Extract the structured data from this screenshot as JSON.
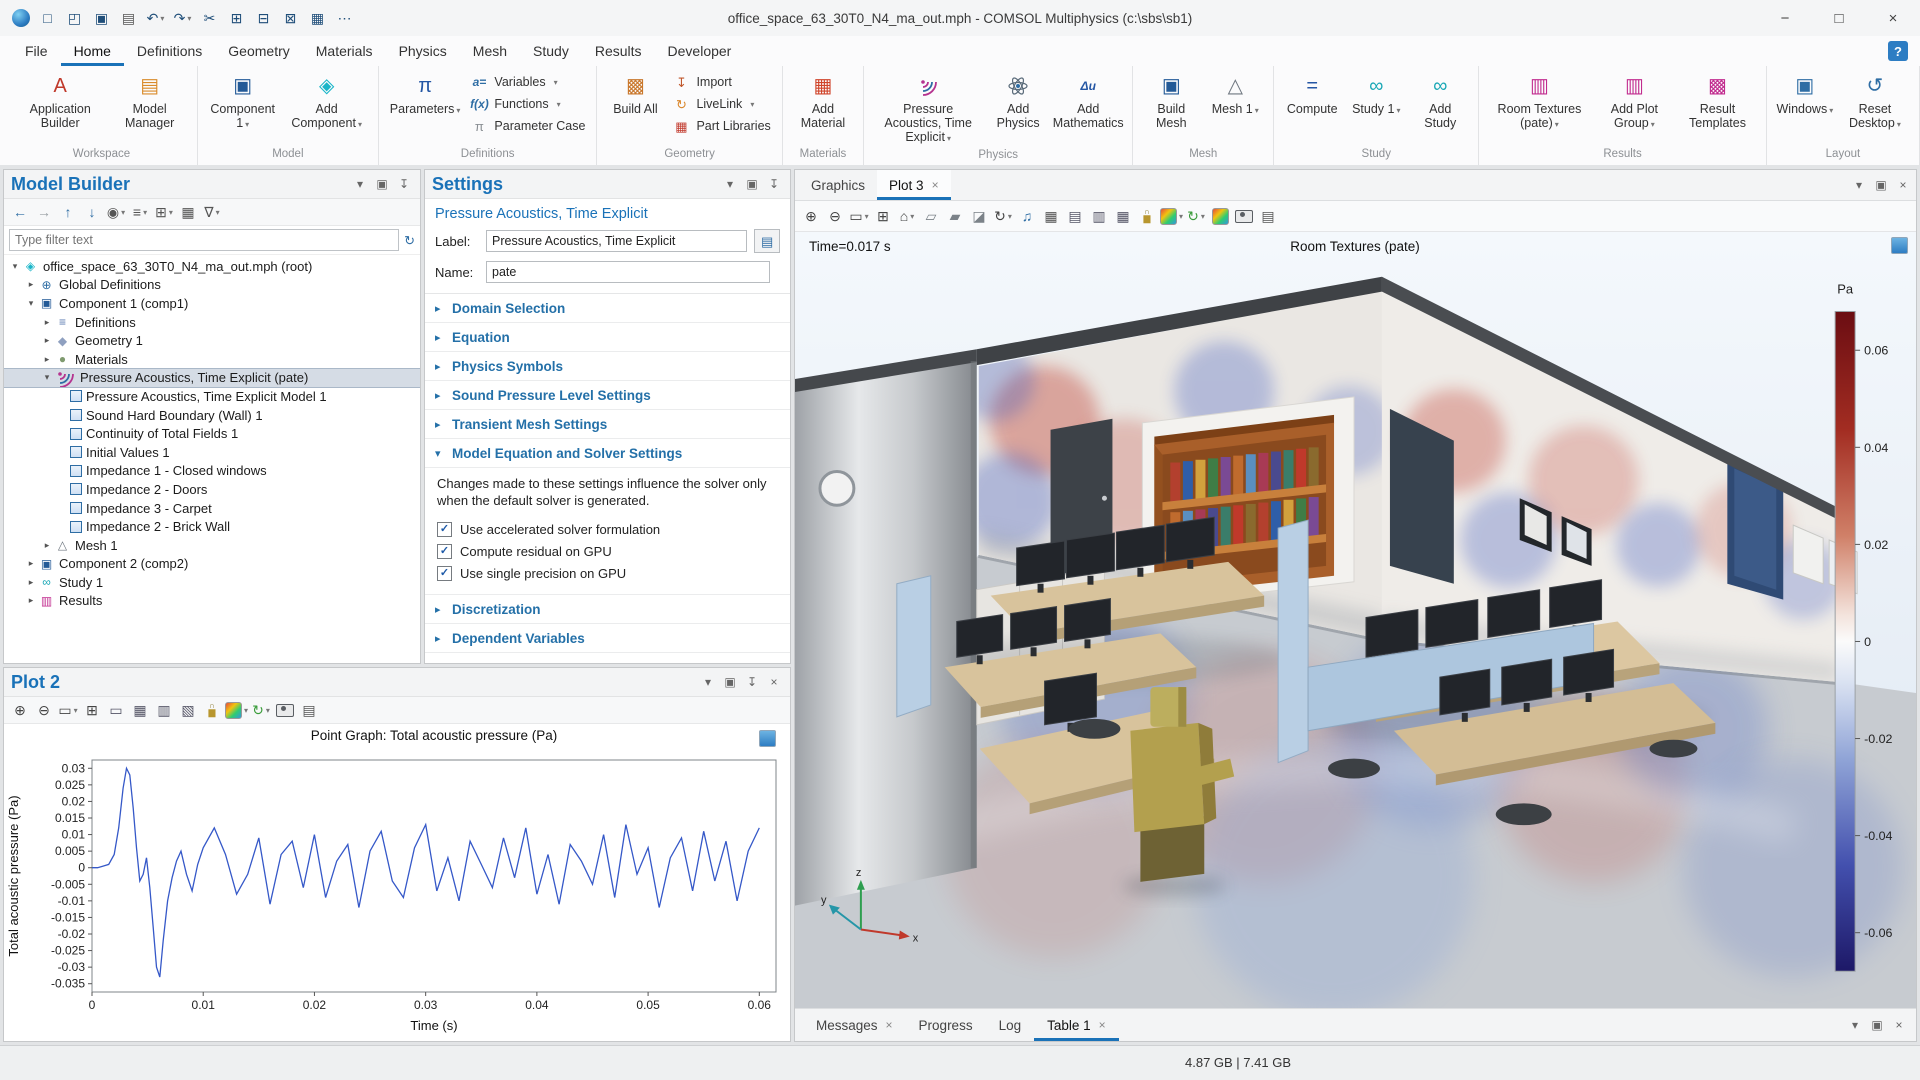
{
  "titlebar": {
    "title": "office_space_63_30T0_N4_ma_out.mph - COMSOL Multiphysics (c:\\sbs\\sb1)",
    "qat": [
      {
        "name": "comsol-logo"
      },
      {
        "name": "new-file"
      },
      {
        "name": "open-file"
      },
      {
        "name": "save"
      },
      {
        "name": "print"
      },
      {
        "name": "undo",
        "dropdown": true
      },
      {
        "name": "redo",
        "dropdown": true
      },
      {
        "name": "cut"
      },
      {
        "name": "copy"
      },
      {
        "name": "paste"
      },
      {
        "name": "delete"
      },
      {
        "name": "model-library"
      },
      {
        "name": "options"
      }
    ],
    "window_controls": [
      "minimize",
      "maximize",
      "close"
    ]
  },
  "menubar": {
    "items": [
      "File",
      "Home",
      "Definitions",
      "Geometry",
      "Materials",
      "Physics",
      "Mesh",
      "Study",
      "Results",
      "Developer"
    ],
    "active": "Home"
  },
  "ribbon": {
    "groups": [
      {
        "caption": "Workspace",
        "large": [
          {
            "label": "Application Builder",
            "icon": "application-builder"
          },
          {
            "label": "Model Manager",
            "icon": "model-manager"
          }
        ]
      },
      {
        "caption": "Model",
        "large": [
          {
            "label": "Component 1",
            "icon": "component",
            "dropdown": true
          },
          {
            "label": "Add Component",
            "icon": "add-component",
            "dropdown": true
          }
        ]
      },
      {
        "caption": "Definitions",
        "large": [
          {
            "label": "Parameters",
            "icon": "parameters",
            "dropdown": true
          }
        ],
        "small": [
          {
            "label": "Variables",
            "icon": "variables",
            "dropdown": true
          },
          {
            "label": "Functions",
            "icon": "functions",
            "dropdown": true
          },
          {
            "label": "Parameter Case",
            "icon": "parameter-case"
          }
        ]
      },
      {
        "caption": "Geometry",
        "large": [
          {
            "label": "Build All",
            "icon": "build-all"
          }
        ],
        "small": [
          {
            "label": "Import",
            "icon": "import"
          },
          {
            "label": "LiveLink",
            "icon": "livelink",
            "dropdown": true
          },
          {
            "label": "Part Libraries",
            "icon": "part-libraries"
          }
        ]
      },
      {
        "caption": "Materials",
        "large": [
          {
            "label": "Add Material",
            "icon": "add-material"
          }
        ]
      },
      {
        "caption": "Physics",
        "large": [
          {
            "label": "Pressure Acoustics, Time Explicit",
            "icon": "acoustics",
            "dropdown": true
          },
          {
            "label": "Add Physics",
            "icon": "add-physics"
          },
          {
            "label": "Add Mathematics",
            "icon": "add-mathematics"
          }
        ]
      },
      {
        "caption": "Mesh",
        "large": [
          {
            "label": "Build Mesh",
            "icon": "build-mesh"
          },
          {
            "label": "Mesh 1",
            "icon": "mesh",
            "dropdown": true
          }
        ]
      },
      {
        "caption": "Study",
        "large": [
          {
            "label": "Compute",
            "icon": "compute"
          },
          {
            "label": "Study 1",
            "icon": "study",
            "dropdown": true
          },
          {
            "label": "Add Study",
            "icon": "add-study"
          }
        ]
      },
      {
        "caption": "Results",
        "large": [
          {
            "label": "Room Textures (pate)",
            "icon": "plot-group",
            "dropdown": true
          },
          {
            "label": "Add Plot Group",
            "icon": "add-plot-group",
            "dropdown": true
          },
          {
            "label": "Result Templates",
            "icon": "result-templates"
          }
        ]
      },
      {
        "caption": "Layout",
        "large": [
          {
            "label": "Windows",
            "icon": "windows-layout",
            "dropdown": true
          },
          {
            "label": "Reset Desktop",
            "icon": "reset-desktop",
            "dropdown": true
          }
        ]
      }
    ]
  },
  "model_builder": {
    "title": "Model Builder",
    "header_icons": [
      "panel-menu",
      "panel-float",
      "panel-pin"
    ],
    "toolbar": [
      {
        "name": "back"
      },
      {
        "name": "forward"
      },
      {
        "name": "move-up"
      },
      {
        "name": "move-down"
      },
      {
        "name": "show",
        "dropdown": true
      },
      {
        "name": "group-nodes",
        "dropdown": true
      },
      {
        "name": "tree-settings",
        "dropdown": true
      },
      {
        "name": "table-view"
      },
      {
        "name": "filter",
        "dropdown": true
      }
    ],
    "filter_placeholder": "Type filter text",
    "tree": [
      {
        "depth": 0,
        "label": "office_space_63_30T0_N4_ma_out.mph (root)",
        "icon": "model-root",
        "expanded": true
      },
      {
        "depth": 1,
        "label": "Global Definitions",
        "icon": "globe",
        "expanded": false
      },
      {
        "depth": 1,
        "label": "Component 1 (comp1)",
        "icon": "component",
        "expanded": true
      },
      {
        "depth": 2,
        "label": "Definitions",
        "icon": "definitions",
        "expanded": false
      },
      {
        "depth": 2,
        "label": "Geometry 1",
        "icon": "geometry",
        "expanded": false
      },
      {
        "depth": 2,
        "label": "Materials",
        "icon": "materials",
        "expanded": false
      },
      {
        "depth": 2,
        "label": "Pressure Acoustics, Time Explicit (pate)",
        "icon": "acoustics",
        "expanded": true,
        "selected": true
      },
      {
        "depth": 3,
        "label": "Pressure Acoustics, Time Explicit Model 1",
        "icon": "node"
      },
      {
        "depth": 3,
        "label": "Sound Hard Boundary (Wall) 1",
        "icon": "node"
      },
      {
        "depth": 3,
        "label": "Continuity of Total Fields 1",
        "icon": "node"
      },
      {
        "depth": 3,
        "label": "Initial Values 1",
        "icon": "node"
      },
      {
        "depth": 3,
        "label": "Impedance 1 - Closed windows",
        "icon": "node"
      },
      {
        "depth": 3,
        "label": "Impedance 2 - Doors",
        "icon": "node"
      },
      {
        "depth": 3,
        "label": "Impedance 3 - Carpet",
        "icon": "node"
      },
      {
        "depth": 3,
        "label": "Impedance 2 - Brick Wall",
        "icon": "node"
      },
      {
        "depth": 2,
        "label": "Mesh 1",
        "icon": "mesh",
        "expanded": false
      },
      {
        "depth": 1,
        "label": "Component 2 (comp2)",
        "icon": "component",
        "expanded": false
      },
      {
        "depth": 1,
        "label": "Study 1",
        "icon": "study",
        "expanded": false
      },
      {
        "depth": 1,
        "label": "Results",
        "icon": "results",
        "expanded": false
      }
    ]
  },
  "settings": {
    "title": "Settings",
    "subtitle": "Pressure Acoustics, Time Explicit",
    "header_icons": [
      "panel-menu",
      "panel-float",
      "panel-pin"
    ],
    "label_caption": "Label:",
    "label_value": "Pressure Acoustics, Time Explicit",
    "name_caption": "Name:",
    "name_value": "pate",
    "sections": [
      {
        "label": "Domain Selection",
        "expanded": false
      },
      {
        "label": "Equation",
        "expanded": false
      },
      {
        "label": "Physics Symbols",
        "expanded": false
      },
      {
        "label": "Sound Pressure Level Settings",
        "expanded": false
      },
      {
        "label": "Transient Mesh Settings",
        "expanded": false
      },
      {
        "label": "Model Equation and Solver Settings",
        "expanded": true,
        "note": "Changes made to these settings influence the solver only when the default solver is generated.",
        "checkboxes": [
          {
            "label": "Use accelerated solver formulation",
            "checked": true
          },
          {
            "label": "Compute residual on GPU",
            "checked": true
          },
          {
            "label": "Use single precision on GPU",
            "checked": true
          }
        ]
      },
      {
        "label": "Discretization",
        "expanded": false
      },
      {
        "label": "Dependent Variables",
        "expanded": false
      }
    ]
  },
  "plot2": {
    "title": "Plot 2",
    "header_icons": [
      "panel-menu",
      "panel-float",
      "panel-pin",
      "panel-close"
    ],
    "toolbar": [
      {
        "name": "zoom-in"
      },
      {
        "name": "zoom-out"
      },
      {
        "name": "zoom-box",
        "dropdown": true
      },
      {
        "name": "zoom-extents"
      },
      {
        "name": "axis-limits"
      },
      {
        "name": "grid-lines"
      },
      {
        "name": "axes-equal"
      },
      {
        "name": "legend-toggle"
      },
      {
        "name": "lock-axes"
      },
      {
        "name": "plot-settings",
        "dropdown": true
      },
      {
        "name": "refresh-plot",
        "dropdown": true
      },
      {
        "name": "snapshot"
      },
      {
        "name": "print"
      }
    ]
  },
  "chart_data": {
    "type": "line",
    "title": "Point Graph: Total acoustic pressure (Pa)",
    "xlabel": "Time (s)",
    "ylabel": "Total acoustic pressure (Pa)",
    "xlim": [
      0,
      0.0615
    ],
    "ylim": [
      -0.0375,
      0.0325
    ],
    "x_ticks": [
      0,
      0.01,
      0.02,
      0.03,
      0.04,
      0.05,
      0.06
    ],
    "y_ticks": [
      0.03,
      0.025,
      0.02,
      0.015,
      0.01,
      0.005,
      0,
      -0.005,
      -0.01,
      -0.015,
      -0.02,
      -0.025,
      -0.03,
      -0.035
    ],
    "grid": false,
    "legend": false,
    "series": [
      {
        "name": "Total acoustic pressure",
        "color": "#3558c8",
        "x": [
          0,
          0.0005,
          0.001,
          0.0015,
          0.002,
          0.0024,
          0.0028,
          0.0031,
          0.0034,
          0.0037,
          0.004,
          0.0043,
          0.0046,
          0.0049,
          0.0052,
          0.0055,
          0.0058,
          0.0061,
          0.0064,
          0.0068,
          0.0072,
          0.0076,
          0.008,
          0.0085,
          0.009,
          0.0095,
          0.01,
          0.011,
          0.012,
          0.013,
          0.014,
          0.015,
          0.016,
          0.017,
          0.018,
          0.019,
          0.02,
          0.021,
          0.022,
          0.023,
          0.024,
          0.025,
          0.026,
          0.027,
          0.028,
          0.029,
          0.03,
          0.031,
          0.032,
          0.033,
          0.034,
          0.035,
          0.036,
          0.037,
          0.038,
          0.039,
          0.04,
          0.041,
          0.042,
          0.043,
          0.044,
          0.045,
          0.046,
          0.047,
          0.048,
          0.049,
          0.05,
          0.051,
          0.052,
          0.053,
          0.054,
          0.055,
          0.056,
          0.057,
          0.058,
          0.059,
          0.06
        ],
        "y": [
          0,
          0,
          0.0005,
          0.001,
          0.004,
          0.012,
          0.024,
          0.03,
          0.028,
          0.018,
          0.006,
          -0.004,
          -0.002,
          0.003,
          -0.006,
          -0.018,
          -0.03,
          -0.033,
          -0.022,
          -0.01,
          -0.003,
          0.002,
          0.005,
          -0.002,
          -0.007,
          0.001,
          0.006,
          0.012,
          0.004,
          -0.008,
          -0.002,
          0.009,
          -0.011,
          0.004,
          0.008,
          -0.006,
          0.01,
          -0.009,
          0.002,
          0.007,
          -0.012,
          0.005,
          0.011,
          -0.004,
          -0.009,
          0.006,
          0.013,
          -0.007,
          0.003,
          -0.01,
          0.008,
          0.001,
          -0.006,
          0.009,
          -0.003,
          0.012,
          -0.008,
          0.004,
          -0.011,
          0.007,
          0.002,
          -0.005,
          0.01,
          -0.009,
          0.013,
          -0.002,
          0.006,
          -0.012,
          0.003,
          0.009,
          -0.007,
          0.011,
          -0.004,
          0.008,
          -0.01,
          0.005,
          0.012
        ]
      }
    ]
  },
  "graphics": {
    "tabs": [
      {
        "label": "Graphics"
      },
      {
        "label": "Plot 3",
        "active": true,
        "closable": true
      }
    ],
    "header_icons": [
      "panel-menu",
      "panel-float",
      "panel-close"
    ],
    "toolbar": [
      {
        "name": "zoom-in"
      },
      {
        "name": "zoom-out"
      },
      {
        "name": "zoom-box",
        "dropdown": true
      },
      {
        "name": "zoom-extents"
      },
      {
        "name": "default-view",
        "dropdown": true
      },
      {
        "name": "view-xy"
      },
      {
        "name": "view-yz"
      },
      {
        "name": "view-zx"
      },
      {
        "name": "rotate",
        "dropdown": true
      },
      {
        "name": "play-sound"
      },
      {
        "name": "table-view"
      },
      {
        "name": "grid-view"
      },
      {
        "name": "split-horizontal"
      },
      {
        "name": "split-vertical"
      },
      {
        "name": "lock-view"
      },
      {
        "name": "color-theme",
        "dropdown": true
      },
      {
        "name": "update-plot",
        "dropdown": true
      },
      {
        "name": "plot-settings"
      },
      {
        "name": "snapshot"
      },
      {
        "name": "print"
      }
    ],
    "time_label": "Time=0.017 s",
    "plot_title": "Room Textures (pate)",
    "colorbar": {
      "unit": "Pa",
      "ticks": [
        "0.06",
        "0.04",
        "0.02",
        "0",
        "-0.02",
        "-0.04",
        "-0.06"
      ],
      "top_color": "#6b0d12",
      "zero_color": "#fbfbfb",
      "bottom_color": "#1d1867"
    },
    "triad": {
      "x": "x",
      "y": "y",
      "z": "z"
    }
  },
  "bottom_panel": {
    "tabs": [
      {
        "label": "Messages",
        "closable": true
      },
      {
        "label": "Progress"
      },
      {
        "label": "Log"
      },
      {
        "label": "Table 1",
        "closable": true,
        "active": true
      }
    ],
    "header_icons": [
      "panel-menu",
      "panel-float",
      "panel-close"
    ]
  },
  "statusbar": {
    "memory": "4.87 GB | 7.41 GB"
  }
}
